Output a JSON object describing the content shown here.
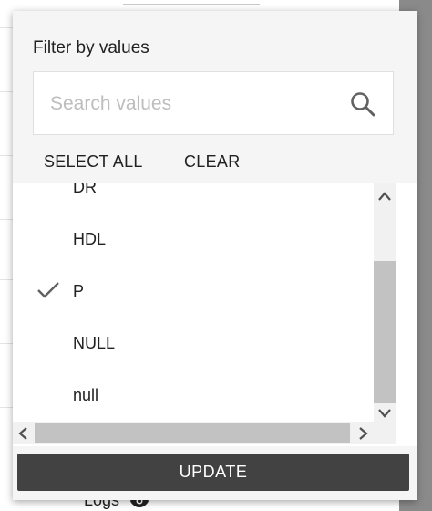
{
  "background": {
    "logs_label": "Logs"
  },
  "filter": {
    "title": "Filter by values",
    "search": {
      "placeholder": "Search values",
      "value": ""
    },
    "select_all_label": "SELECT ALL",
    "clear_label": "CLEAR",
    "items": [
      {
        "label": "DR",
        "checked": false
      },
      {
        "label": "HDL",
        "checked": false
      },
      {
        "label": "P",
        "checked": true
      },
      {
        "label": "NULL",
        "checked": false
      },
      {
        "label": "null",
        "checked": false
      }
    ],
    "update_label": "UPDATE"
  }
}
